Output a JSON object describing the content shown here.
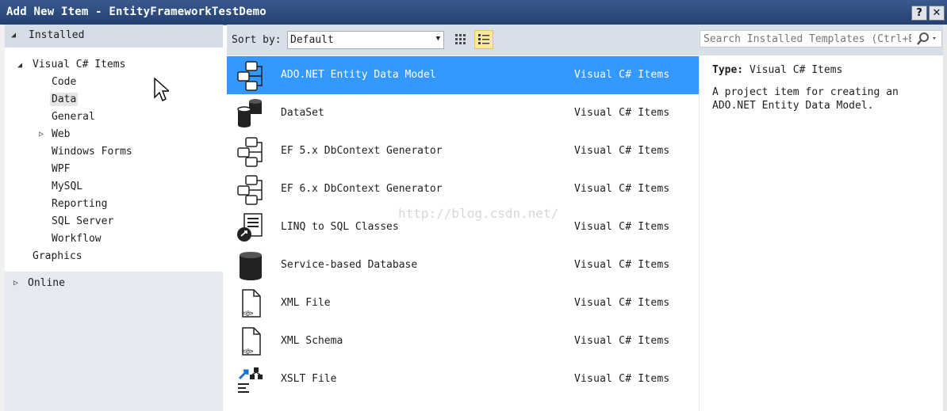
{
  "window": {
    "title": "Add New Item - EntityFrameworkTestDemo",
    "help_label": "?",
    "close_label": "✕"
  },
  "tree": {
    "installed": "Installed",
    "visual_csharp": "Visual C# Items",
    "children": [
      "Code",
      "Data",
      "General",
      "Web",
      "Windows Forms",
      "WPF",
      "MySQL",
      "Reporting",
      "SQL Server",
      "Workflow"
    ],
    "graphics": "Graphics",
    "online": "Online",
    "selected": "Data"
  },
  "toolbar": {
    "sort_label": "Sort by:",
    "sort_value": "Default"
  },
  "search": {
    "placeholder": "Search Installed Templates (Ctrl+E)"
  },
  "items": [
    {
      "name": "ADO.NET Entity Data Model",
      "category": "Visual C# Items",
      "icon": "entity-model-icon",
      "selected": true
    },
    {
      "name": "DataSet",
      "category": "Visual C# Items",
      "icon": "dataset-icon"
    },
    {
      "name": "EF 5.x DbContext Generator",
      "category": "Visual C# Items",
      "icon": "ef-generator-icon"
    },
    {
      "name": "EF 6.x DbContext Generator",
      "category": "Visual C# Items",
      "icon": "ef-generator-icon"
    },
    {
      "name": "LINQ to SQL Classes",
      "category": "Visual C# Items",
      "icon": "linq-icon"
    },
    {
      "name": "Service-based Database",
      "category": "Visual C# Items",
      "icon": "database-icon"
    },
    {
      "name": "XML File",
      "category": "Visual C# Items",
      "icon": "xml-file-icon"
    },
    {
      "name": "XML Schema",
      "category": "Visual C# Items",
      "icon": "xml-schema-icon"
    },
    {
      "name": "XSLT File",
      "category": "Visual C# Items",
      "icon": "xslt-file-icon"
    }
  ],
  "details": {
    "type_label": "Type:",
    "type_value": "Visual C# Items",
    "description": "A project item for creating an ADO.NET Entity Data Model."
  },
  "watermark": "http://blog.csdn.net/",
  "colors": {
    "selection": "#3399ff",
    "titlebar": "#2b4a7c",
    "toolbar": "#d9dfe9",
    "left_header": "#d5dce8"
  }
}
